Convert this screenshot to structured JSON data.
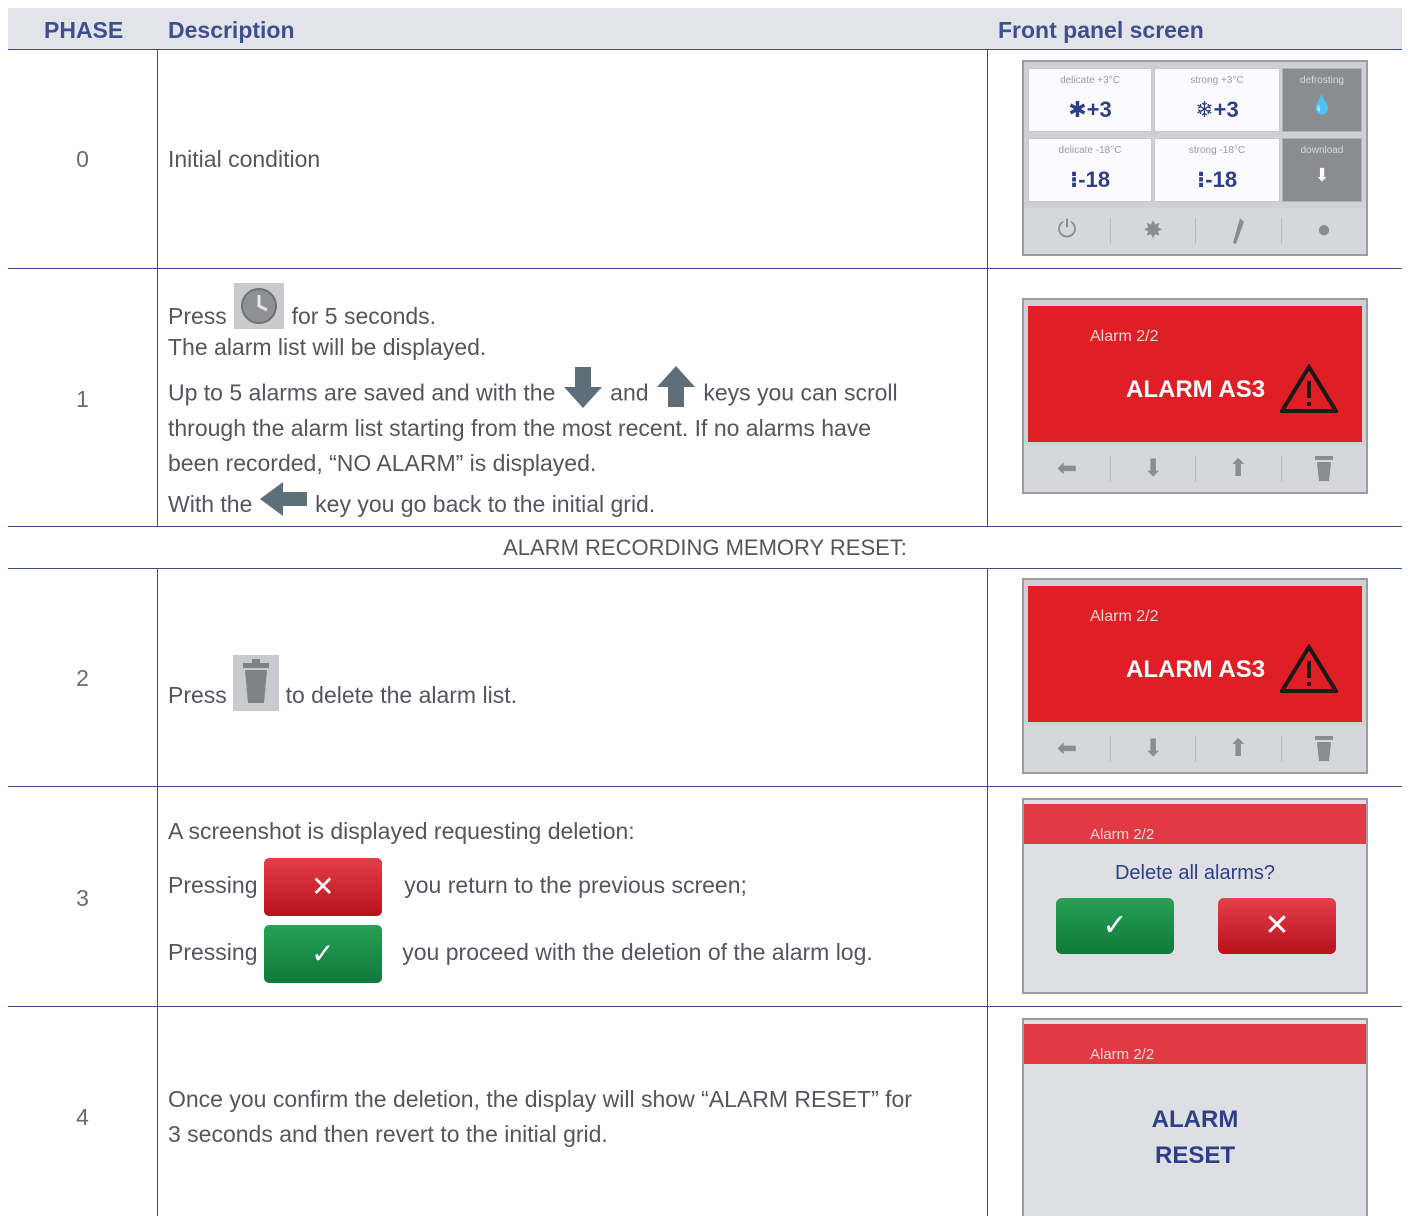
{
  "header": {
    "phase": "PHASE",
    "description": "Description",
    "screen": "Front panel screen"
  },
  "rows": [
    {
      "phase": "0",
      "text": "Initial condition"
    },
    {
      "phase": "1",
      "l1a": "Press",
      "l1b": "for 5 seconds.",
      "l2": "The alarm list will be displayed.",
      "l3a": "Up to 5 alarms are saved and with the",
      "l3b": "and",
      "l3c": "keys you can scroll",
      "l4": "through the alarm list starting from the most recent. If no alarms have",
      "l5": "been recorded, “NO ALARM” is displayed.",
      "l6a": "With the",
      "l6b": "key you go back to the initial grid."
    },
    {
      "phase": "2",
      "l1a": "Press",
      "l1b": "to delete the alarm list."
    },
    {
      "phase": "3",
      "l1": "A screenshot is displayed requesting deletion:",
      "l2a": "Pressing",
      "l2b": "you return to the previous screen;",
      "l3a": "Pressing",
      "l3b": "you proceed with the deletion of the alarm log."
    },
    {
      "phase": "4",
      "l1": "Once you confirm the deletion, the display will show “ALARM RESET” for",
      "l2": "3 seconds and then revert to the initial grid."
    }
  ],
  "subheader": "ALARM RECORDING MEMORY RESET:",
  "screens": {
    "grid": {
      "tiles": [
        {
          "label": "delicate +3°C",
          "value": "✱+3"
        },
        {
          "label": "strong +3°C",
          "value": "❄+3"
        },
        {
          "label": "delicate -18°C",
          "value": "⁝-18"
        },
        {
          "label": "strong -18°C",
          "value": "⁝-18"
        }
      ],
      "defrost_label": "defrosting",
      "download_label": "download"
    },
    "alarm": {
      "counter": "Alarm 2/2",
      "code": "ALARM AS3"
    },
    "confirm": {
      "counter": "Alarm 2/2",
      "question": "Delete all alarms?"
    },
    "reset": {
      "counter": "Alarm 2/2",
      "line1": "ALARM",
      "line2": "RESET"
    }
  },
  "icons": {
    "clock": "clock-icon",
    "arrow_down": "arrow-down-icon",
    "arrow_up": "arrow-up-icon",
    "arrow_left": "arrow-left-icon",
    "trash": "trash-icon",
    "check": "✓",
    "cross": "✕",
    "power": "⏻",
    "gear": "✸",
    "wrench": "wrench-icon",
    "drop": "drop-icon"
  },
  "colors": {
    "header_text": "#3d4f8f",
    "alarm_red": "#e01e25",
    "confirm_green": "#17853f",
    "cancel_red": "#c8161f"
  }
}
